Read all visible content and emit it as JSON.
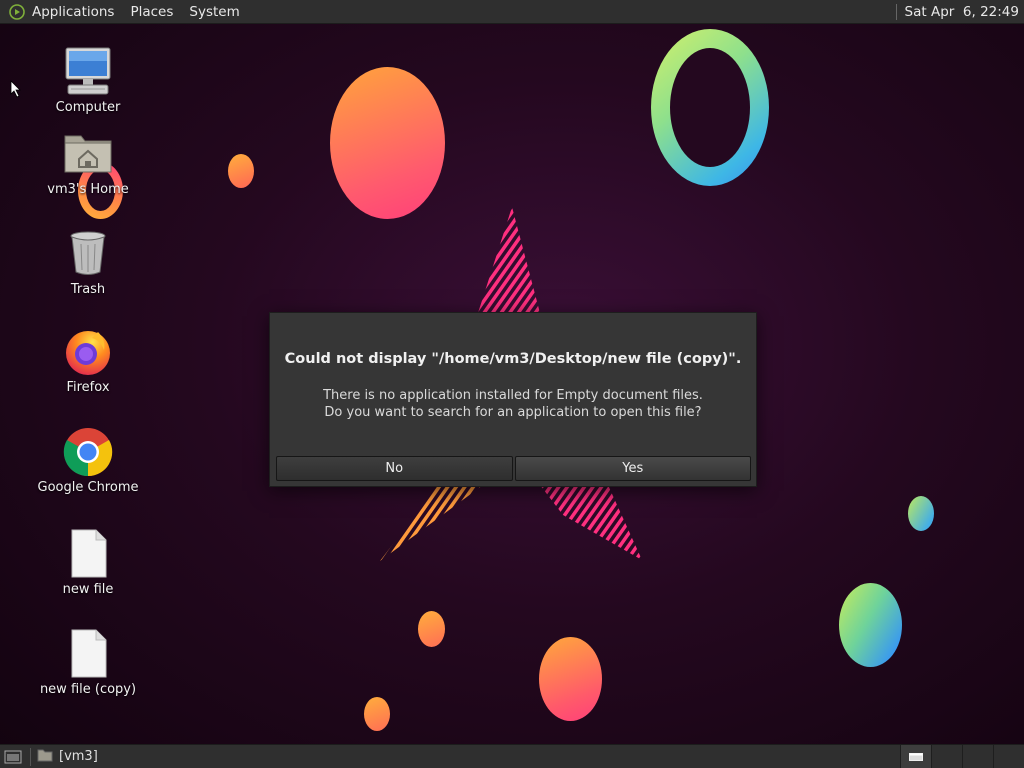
{
  "top_panel": {
    "menus": [
      "Applications",
      "Places",
      "System"
    ],
    "clock": "Sat Apr  6, 22:49"
  },
  "desktop": {
    "icons": [
      {
        "label": "Computer",
        "icon": "computer-icon"
      },
      {
        "label": "vm3's Home",
        "icon": "home-folder-icon"
      },
      {
        "label": "Trash",
        "icon": "trash-icon"
      },
      {
        "label": "Firefox",
        "icon": "firefox-icon"
      },
      {
        "label": "Google Chrome",
        "icon": "chrome-icon"
      },
      {
        "label": "new file",
        "icon": "document-icon"
      },
      {
        "label": "new file (copy)",
        "icon": "document-icon"
      }
    ]
  },
  "dialog": {
    "title": "Could not display \"/home/vm3/Desktop/new file (copy)\".",
    "message_line1": "There is no application installed for Empty document files.",
    "message_line2": "Do you want to search for an application to open this file?",
    "no_label": "No",
    "yes_label": "Yes"
  },
  "bottom_panel": {
    "task_label": "[vm3]",
    "workspaces": 4
  },
  "colors": {
    "panel": "#2f2f2f",
    "dialog_bg": "#363636",
    "wallpaper": "#24081f"
  }
}
